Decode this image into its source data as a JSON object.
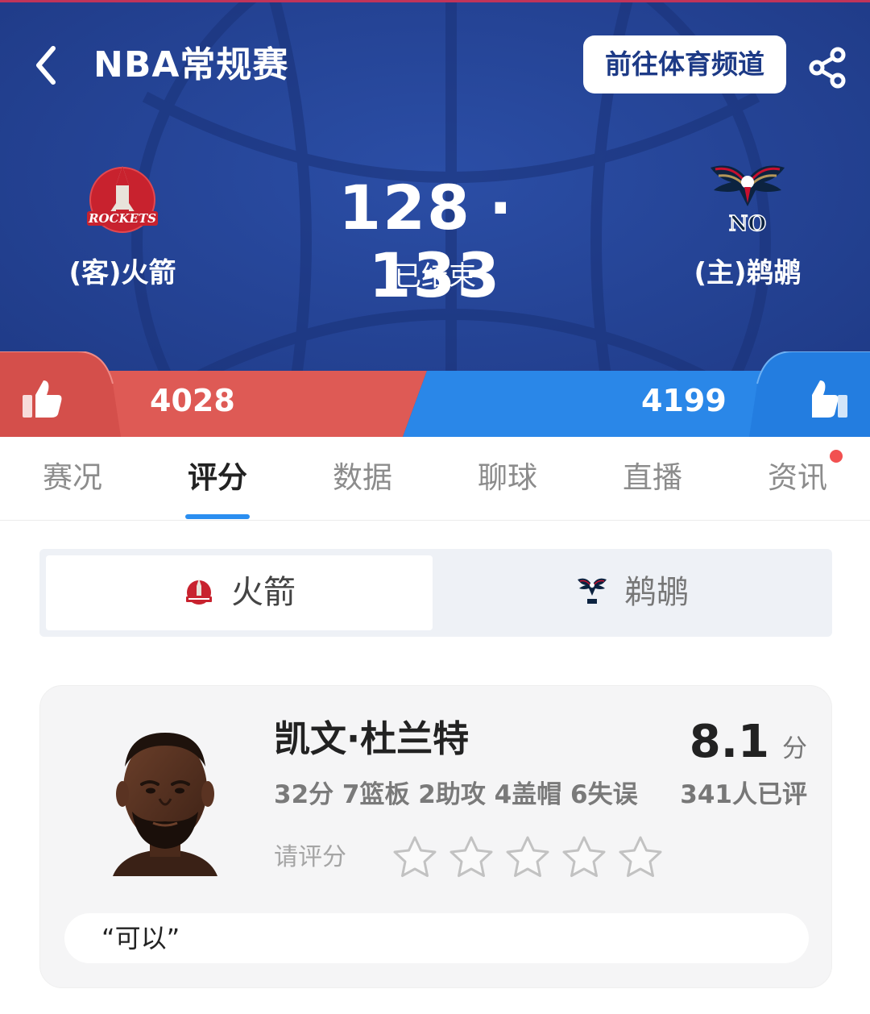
{
  "header": {
    "title": "NBA常规赛",
    "channel_button": "前往体育频道",
    "icons": {
      "back": "chevron-left-icon",
      "share": "share-icon"
    }
  },
  "match": {
    "away_team": {
      "name": "(客)火箭",
      "logo": "rockets-logo",
      "logo_text": "ROCKETS"
    },
    "home_team": {
      "name": "(主)鹈鹕",
      "logo": "pelicans-logo",
      "logo_text": "NO"
    },
    "away_score": "128",
    "separator": "·",
    "home_score": "133",
    "status": "已结束"
  },
  "votes": {
    "away_count": "4028",
    "home_count": "4199",
    "away_color": "#de5a55",
    "home_color": "#2a87e8",
    "icon": "thumbs-up-icon"
  },
  "tabs": [
    {
      "label": "赛况",
      "active": false
    },
    {
      "label": "评分",
      "active": true
    },
    {
      "label": "数据",
      "active": false
    },
    {
      "label": "聊球",
      "active": false
    },
    {
      "label": "直播",
      "active": false
    },
    {
      "label": "资讯",
      "active": false,
      "badge": true
    }
  ],
  "team_switch": {
    "away_label": "火箭",
    "home_label": "鹈鹕"
  },
  "player": {
    "name": "凯文·杜兰特",
    "stats": "32分 7篮板 2助攻 4盖帽 6失误",
    "rating": "8.1",
    "rating_unit": "分",
    "rating_count": "341人已评",
    "rate_prompt": "请评分",
    "stars_total": 5,
    "stars_selected": 0,
    "comment": "“可以”"
  },
  "colors": {
    "header_bg": "#23408f",
    "accent": "#2a8ef0",
    "badge": "#f25050"
  }
}
